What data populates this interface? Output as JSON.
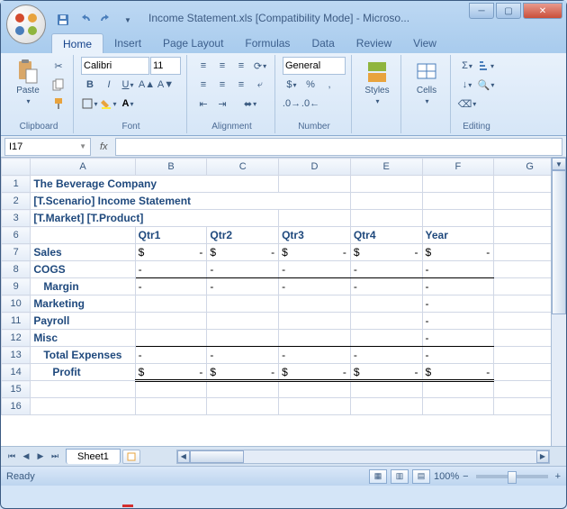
{
  "window": {
    "title": "Income Statement.xls  [Compatibility Mode] - Microso..."
  },
  "tabs": [
    "Home",
    "Insert",
    "Page Layout",
    "Formulas",
    "Data",
    "Review",
    "View"
  ],
  "active_tab": 0,
  "ribbon": {
    "clipboard": {
      "label": "Clipboard",
      "paste": "Paste"
    },
    "font": {
      "label": "Font",
      "name": "Calibri",
      "size": "11"
    },
    "alignment": {
      "label": "Alignment"
    },
    "number": {
      "label": "Number",
      "format": "General"
    },
    "styles": {
      "label": "Styles"
    },
    "cells": {
      "label": "Cells"
    },
    "editing": {
      "label": "Editing"
    }
  },
  "name_box": "I17",
  "fx": "fx",
  "columns": [
    "A",
    "B",
    "C",
    "D",
    "E",
    "F",
    "G"
  ],
  "row_nums": [
    "1",
    "2",
    "3",
    "6",
    "7",
    "8",
    "9",
    "10",
    "11",
    "12",
    "13",
    "14",
    "15",
    "16"
  ],
  "headers": [
    "Qtr1",
    "Qtr2",
    "Qtr3",
    "Qtr4",
    "Year"
  ],
  "labels": {
    "title1": "The Beverage Company",
    "title2": "[T.Scenario] Income Statement",
    "title3": "[T.Market] [T.Product]",
    "sales": "Sales",
    "cogs": "COGS",
    "margin": "Margin",
    "marketing": "Marketing",
    "payroll": "Payroll",
    "misc": "Misc",
    "total_exp": "Total Expenses",
    "profit": "Profit"
  },
  "dollar": "$",
  "dash": "-",
  "sheet": {
    "name": "Sheet1"
  },
  "status": {
    "ready": "Ready",
    "zoom": "100%"
  }
}
